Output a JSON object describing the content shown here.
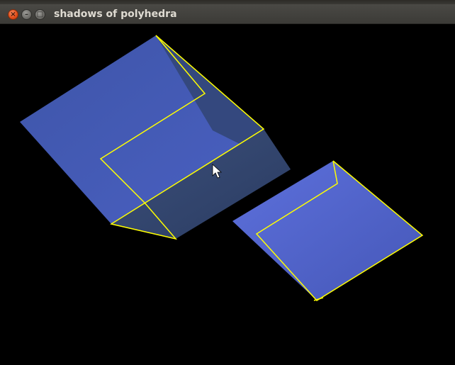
{
  "window": {
    "title": "shadows of polyhedra",
    "buttons": {
      "close": "close",
      "minimize": "minimize",
      "maximize": "maximize"
    }
  },
  "icons": {
    "close": "close-icon",
    "minimize": "minimize-icon",
    "maximize": "maximize-icon",
    "cursor": "mouse-pointer-icon"
  },
  "colors": {
    "background": "#000000",
    "face_light": "#5566d0",
    "face_mid": "#4658b4",
    "face_dark": "#2f4470",
    "edge_outline": "#ffff00",
    "titlebar": "#3c3b37",
    "close_button": "#df4a16"
  },
  "scene": {
    "objects": [
      {
        "name": "solid",
        "description_visible": false
      },
      {
        "name": "shadow",
        "description_visible": false
      }
    ]
  }
}
